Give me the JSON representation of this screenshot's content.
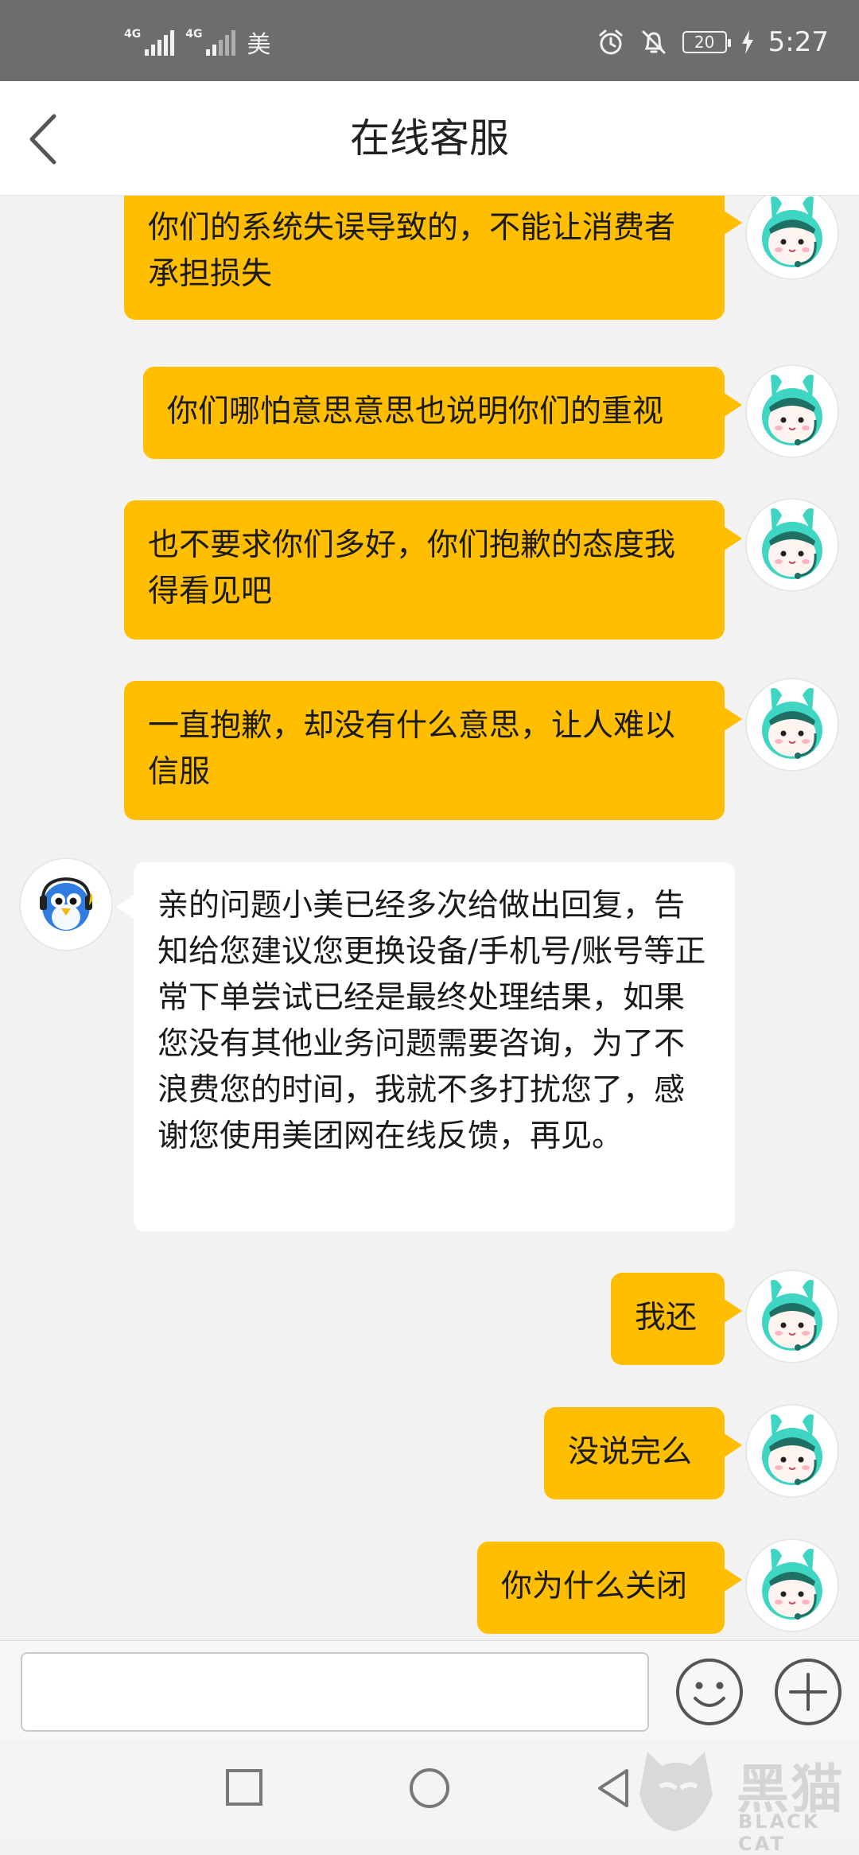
{
  "status_bar": {
    "signal1_tag": "4G",
    "signal2_tag": "4G",
    "carrier": "美",
    "battery": "20",
    "time": "5:27"
  },
  "header": {
    "title": "在线客服"
  },
  "messages": [
    {
      "from": "user",
      "text": "你们的系统失误导致的，不能让消费者承担损失"
    },
    {
      "from": "user",
      "text": "你们哪怕意思意思也说明你们的重视"
    },
    {
      "from": "user",
      "text": "也不要求你们多好，你们抱歉的态度我得看见吧"
    },
    {
      "from": "user",
      "text": "一直抱歉，却没有什么意思，让人难以信服"
    },
    {
      "from": "agent",
      "text": "亲的问题小美已经多次给做出回复，告知给您建议您更换设备/手机号/账号等正常下单尝试已经是最终处理结果，如果您没有其他业务问题需要咨询，为了不浪费您的时间，我就不多打扰您了，感谢您使用美团网在线反馈，再见。"
    },
    {
      "from": "user",
      "text": "我还"
    },
    {
      "from": "user",
      "text": "没说完么"
    },
    {
      "from": "user",
      "text": "你为什么关闭"
    }
  ],
  "input": {
    "value": "",
    "placeholder": ""
  },
  "icons": {
    "back": "chevron-left-icon",
    "emoji": "smiley-icon",
    "plus": "plus-icon",
    "alarm": "alarm-icon",
    "mute": "bell-off-icon",
    "charging": "bolt-icon"
  },
  "colors": {
    "user_bubble": "#ffbf00",
    "agent_bubble": "#ffffff",
    "status_bar": "#6d6d6d",
    "avatar_teal": "#3fd5c3"
  },
  "watermark": {
    "title": "黑猫",
    "subtitle": "BLACK CAT"
  }
}
